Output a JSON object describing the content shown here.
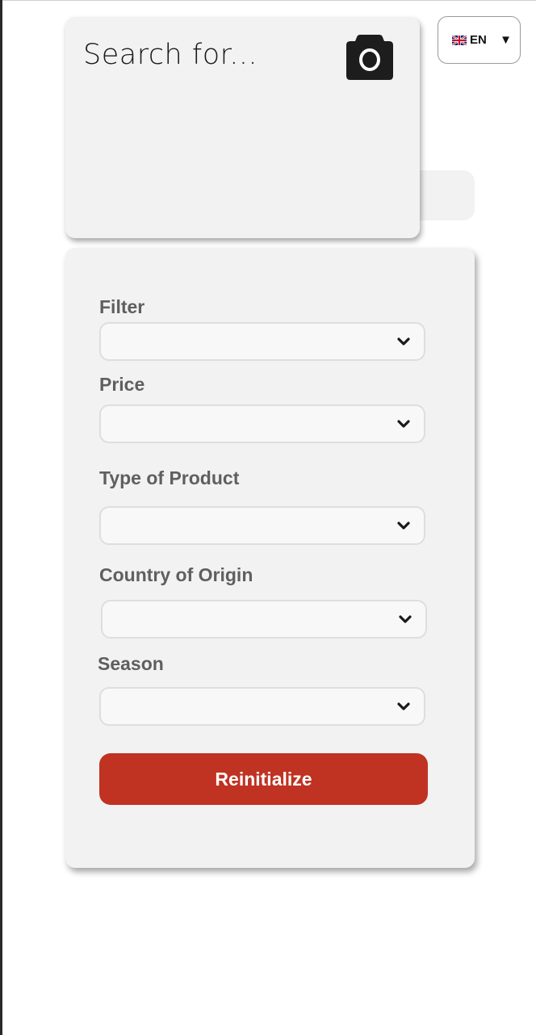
{
  "language": {
    "code": "EN",
    "flag_icon": "uk-flag-icon",
    "caret_icon": "triangle-down-icon"
  },
  "search": {
    "placeholder": "Search for...",
    "camera_icon": "camera-icon"
  },
  "filters": {
    "fields": [
      {
        "label": "Filter",
        "value": ""
      },
      {
        "label": "Price",
        "value": ""
      },
      {
        "label": "Type of Product",
        "value": ""
      },
      {
        "label": "Country of Origin",
        "value": ""
      },
      {
        "label": "Season",
        "value": ""
      }
    ],
    "reset_label": "Reinitialize"
  },
  "colors": {
    "accent": "#c03222",
    "card": "#f2f2f2",
    "select_bg": "#f9f8f9",
    "label": "#5f5f5f"
  }
}
